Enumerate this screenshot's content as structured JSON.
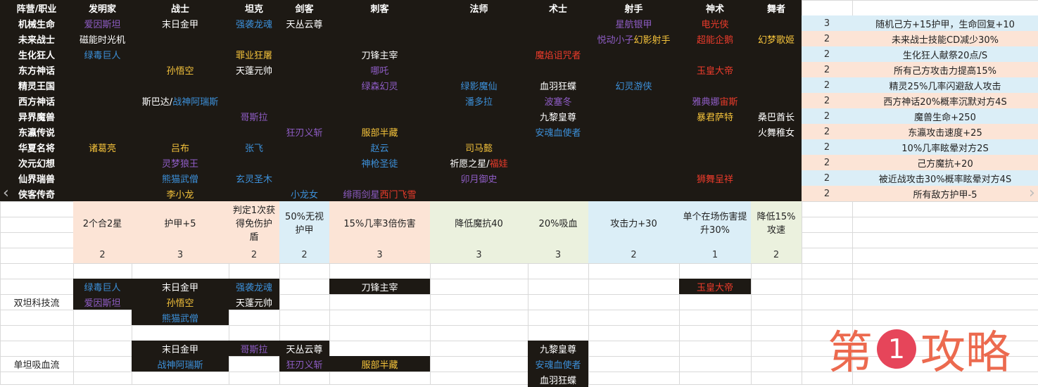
{
  "colors": {
    "orange": "#f5c33b",
    "blue": "#3c8fd8",
    "purple": "#8f5dc6",
    "red": "#ec3b2b",
    "white": "#ffffff",
    "black_cell": "#1d1914",
    "lightblue": "#dbeef7",
    "peach": "#fce4d6",
    "lightgreen": "#ebf1de",
    "grid": "#d9d9d9"
  },
  "header": [
    "阵营/职业",
    "发明家",
    "战士",
    "坦克",
    "剑客",
    "刺客",
    "法师",
    "术士",
    "射手",
    "神术",
    "舞者"
  ],
  "factions": [
    "机械生命",
    "未来战士",
    "生化狂人",
    "东方神话",
    "精灵王国",
    "西方神话",
    "异界魔兽",
    "东瀛传说",
    "华夏名将",
    "次元幻想",
    "仙界瑞兽",
    "侠客传奇"
  ],
  "cells": [
    {
      "r": 0,
      "c": 1,
      "t": [
        {
          "s": "爱因斯坦",
          "k": "purple"
        }
      ]
    },
    {
      "r": 0,
      "c": 2,
      "t": [
        {
          "s": "末日金甲",
          "k": "white"
        }
      ]
    },
    {
      "r": 0,
      "c": 3,
      "t": [
        {
          "s": "强袭龙魂",
          "k": "blue"
        }
      ]
    },
    {
      "r": 0,
      "c": 4,
      "t": [
        {
          "s": "天丛云尊",
          "k": "white"
        }
      ]
    },
    {
      "r": 0,
      "c": 8,
      "t": [
        {
          "s": "星航银甲",
          "k": "purple"
        }
      ]
    },
    {
      "r": 0,
      "c": 9,
      "t": [
        {
          "s": "电光侠",
          "k": "red"
        }
      ]
    },
    {
      "r": 1,
      "c": 1,
      "t": [
        {
          "s": "磁能时光机",
          "k": "white"
        }
      ]
    },
    {
      "r": 1,
      "c": 8,
      "t": [
        {
          "s": "悦动小子",
          "k": "purple"
        },
        {
          "s": " 幻影射手",
          "k": "orange"
        }
      ]
    },
    {
      "r": 1,
      "c": 9,
      "t": [
        {
          "s": "超能企鹅",
          "k": "red"
        }
      ]
    },
    {
      "r": 1,
      "c": 10,
      "t": [
        {
          "s": "幻梦歌姬",
          "k": "orange"
        }
      ]
    },
    {
      "r": 2,
      "c": 1,
      "t": [
        {
          "s": "绿毒巨人",
          "k": "blue"
        }
      ]
    },
    {
      "r": 2,
      "c": 3,
      "t": [
        {
          "s": "罪业狂屠",
          "k": "orange"
        }
      ]
    },
    {
      "r": 2,
      "c": 5,
      "t": [
        {
          "s": "刀锋主宰",
          "k": "white"
        }
      ]
    },
    {
      "r": 2,
      "c": 7,
      "t": [
        {
          "s": "魔焰诅咒者",
          "k": "red"
        }
      ]
    },
    {
      "r": 3,
      "c": 2,
      "t": [
        {
          "s": "孙悟空",
          "k": "orange"
        }
      ]
    },
    {
      "r": 3,
      "c": 3,
      "t": [
        {
          "s": "天蓬元帅",
          "k": "white"
        }
      ]
    },
    {
      "r": 3,
      "c": 5,
      "t": [
        {
          "s": "哪吒",
          "k": "purple"
        }
      ]
    },
    {
      "r": 3,
      "c": 9,
      "t": [
        {
          "s": "玉皇大帝",
          "k": "red"
        }
      ]
    },
    {
      "r": 4,
      "c": 5,
      "t": [
        {
          "s": "绿森幻灵",
          "k": "purple"
        }
      ]
    },
    {
      "r": 4,
      "c": 6,
      "t": [
        {
          "s": "绿影魔仙",
          "k": "blue"
        }
      ]
    },
    {
      "r": 4,
      "c": 7,
      "t": [
        {
          "s": "血羽狂蝶",
          "k": "white"
        }
      ]
    },
    {
      "r": 4,
      "c": 8,
      "t": [
        {
          "s": "幻灵游侠",
          "k": "blue"
        }
      ]
    },
    {
      "r": 5,
      "c": 2,
      "t": [
        {
          "s": "斯巴达/",
          "k": "white"
        },
        {
          "s": "战神阿瑞斯",
          "k": "blue"
        }
      ]
    },
    {
      "r": 5,
      "c": 6,
      "t": [
        {
          "s": "潘多拉",
          "k": "blue"
        }
      ]
    },
    {
      "r": 5,
      "c": 7,
      "t": [
        {
          "s": "波塞冬",
          "k": "purple"
        }
      ]
    },
    {
      "r": 5,
      "c": 9,
      "t": [
        {
          "s": "雅典娜",
          "k": "purple"
        },
        {
          "s": " 宙斯",
          "k": "red"
        }
      ]
    },
    {
      "r": 6,
      "c": 3,
      "t": [
        {
          "s": "哥斯拉",
          "k": "purple"
        }
      ]
    },
    {
      "r": 6,
      "c": 7,
      "t": [
        {
          "s": "九黎皇尊",
          "k": "white"
        }
      ]
    },
    {
      "r": 6,
      "c": 9,
      "t": [
        {
          "s": "暴君萨特",
          "k": "orange"
        }
      ]
    },
    {
      "r": 6,
      "c": 10,
      "t": [
        {
          "s": "桑巴酋长",
          "k": "white"
        }
      ]
    },
    {
      "r": 7,
      "c": 4,
      "t": [
        {
          "s": "狂刃义斩",
          "k": "purple"
        }
      ]
    },
    {
      "r": 7,
      "c": 5,
      "t": [
        {
          "s": "服部半藏",
          "k": "orange"
        }
      ]
    },
    {
      "r": 7,
      "c": 7,
      "t": [
        {
          "s": "安魂血使者",
          "k": "blue"
        }
      ]
    },
    {
      "r": 7,
      "c": 10,
      "t": [
        {
          "s": "火舞稚女",
          "k": "white"
        }
      ]
    },
    {
      "r": 8,
      "c": 1,
      "t": [
        {
          "s": "诸葛亮",
          "k": "orange"
        }
      ]
    },
    {
      "r": 8,
      "c": 2,
      "t": [
        {
          "s": "吕布",
          "k": "orange"
        }
      ]
    },
    {
      "r": 8,
      "c": 3,
      "t": [
        {
          "s": "张飞",
          "k": "blue"
        }
      ]
    },
    {
      "r": 8,
      "c": 5,
      "t": [
        {
          "s": "赵云",
          "k": "blue"
        }
      ]
    },
    {
      "r": 8,
      "c": 6,
      "t": [
        {
          "s": "司马懿",
          "k": "orange"
        }
      ]
    },
    {
      "r": 9,
      "c": 2,
      "t": [
        {
          "s": "灵梦狼王",
          "k": "purple"
        }
      ]
    },
    {
      "r": 9,
      "c": 5,
      "t": [
        {
          "s": "神枪圣徒",
          "k": "blue"
        }
      ]
    },
    {
      "r": 9,
      "c": 6,
      "t": [
        {
          "s": "祈愿之星/",
          "k": "white"
        },
        {
          "s": "福娃",
          "k": "red"
        }
      ]
    },
    {
      "r": 10,
      "c": 2,
      "t": [
        {
          "s": "熊猫武僧",
          "k": "blue"
        }
      ]
    },
    {
      "r": 10,
      "c": 3,
      "t": [
        {
          "s": "玄灵圣木",
          "k": "blue"
        }
      ]
    },
    {
      "r": 10,
      "c": 6,
      "t": [
        {
          "s": "卯月御史",
          "k": "purple"
        }
      ]
    },
    {
      "r": 10,
      "c": 9,
      "t": [
        {
          "s": "狮舞呈祥",
          "k": "red"
        }
      ]
    },
    {
      "r": 11,
      "c": 2,
      "t": [
        {
          "s": "李小龙",
          "k": "orange"
        }
      ]
    },
    {
      "r": 11,
      "c": 4,
      "t": [
        {
          "s": "小龙女",
          "k": "blue"
        }
      ]
    },
    {
      "r": 11,
      "c": 5,
      "t": [
        {
          "s": "绯雨剑星",
          "k": "purple"
        },
        {
          "s": " ",
          "k": "white"
        },
        {
          "s": "西门飞雪",
          "k": "red"
        }
      ]
    }
  ],
  "faction_bonus": [
    {
      "n": "3",
      "e": "随机己方+15护甲，生命回复+10"
    },
    {
      "n": "2",
      "e": "未来战士技能CD减少30%"
    },
    {
      "n": "2",
      "e": "生化狂人献祭20点/S"
    },
    {
      "n": "2",
      "e": "所有己方攻击力提高15%"
    },
    {
      "n": "2",
      "e": "精灵25%几率闪避敌人攻击"
    },
    {
      "n": "2",
      "e": "西方神话20%概率沉默对方4S"
    },
    {
      "n": "2",
      "e": "魔兽生命+250"
    },
    {
      "n": "2",
      "e": "东瀛攻击速度+25"
    },
    {
      "n": "2",
      "e": "10%几率眩晕对方2S"
    },
    {
      "n": "2",
      "e": "己方魔抗+20"
    },
    {
      "n": "2",
      "e": "被近战攻击30%概率眩晕对方4S"
    },
    {
      "n": "2",
      "e": "所有敌方护甲-5"
    }
  ],
  "class_bonus": [
    {
      "c": 1,
      "e": "2个合2星",
      "n": "2"
    },
    {
      "c": 2,
      "e": "护甲+5",
      "n": "3"
    },
    {
      "c": 3,
      "e": "判定1次获得免伤护盾",
      "n": "2"
    },
    {
      "c": 4,
      "e": "50%无视护甲",
      "n": "2"
    },
    {
      "c": 5,
      "e": "15%几率3倍伤害",
      "n": "3"
    },
    {
      "c": 6,
      "e": "降低魔抗40",
      "n": "3"
    },
    {
      "c": 7,
      "e": "20%吸血",
      "n": "3"
    },
    {
      "c": 8,
      "e": "攻击力+30",
      "n": "2"
    },
    {
      "c": 9,
      "e": "单个在场伤害提升30%",
      "n": "1"
    },
    {
      "c": 10,
      "e": "降低15%攻速",
      "n": "2"
    }
  ],
  "builds": [
    {
      "name": "双坦科技流",
      "units": [
        {
          "r": 0,
          "c": 1,
          "s": "绿毒巨人",
          "k": "blue"
        },
        {
          "r": 0,
          "c": 2,
          "s": "末日金甲",
          "k": "white"
        },
        {
          "r": 0,
          "c": 3,
          "s": "强袭龙魂",
          "k": "blue"
        },
        {
          "r": 0,
          "c": 5,
          "s": "刀锋主宰",
          "k": "white"
        },
        {
          "r": 0,
          "c": 9,
          "s": "玉皇大帝",
          "k": "red"
        },
        {
          "r": 1,
          "c": 1,
          "s": "爱因斯坦",
          "k": "purple"
        },
        {
          "r": 1,
          "c": 2,
          "s": "孙悟空",
          "k": "orange"
        },
        {
          "r": 1,
          "c": 3,
          "s": "天蓬元帅",
          "k": "white"
        },
        {
          "r": 2,
          "c": 2,
          "s": "熊猫武僧",
          "k": "blue"
        }
      ]
    },
    {
      "name": "单坦吸血流",
      "units": [
        {
          "r": 0,
          "c": 2,
          "s": "末日金甲",
          "k": "white"
        },
        {
          "r": 0,
          "c": 3,
          "s": "哥斯拉",
          "k": "purple"
        },
        {
          "r": 0,
          "c": 4,
          "s": "天丛云尊",
          "k": "white"
        },
        {
          "r": 0,
          "c": 7,
          "s": "九黎皇尊",
          "k": "white"
        },
        {
          "r": 1,
          "c": 2,
          "s": "战神阿瑞斯",
          "k": "blue"
        },
        {
          "r": 1,
          "c": 4,
          "s": "狂刃义斩",
          "k": "purple"
        },
        {
          "r": 1,
          "c": 5,
          "s": "服部半藏",
          "k": "orange"
        },
        {
          "r": 1,
          "c": 7,
          "s": "安魂血使者",
          "k": "blue"
        },
        {
          "r": 2,
          "c": 7,
          "s": "血羽狂蝶",
          "k": "white"
        }
      ]
    }
  ],
  "watermark": {
    "left": "第",
    "mid": "1",
    "right": "攻略"
  }
}
